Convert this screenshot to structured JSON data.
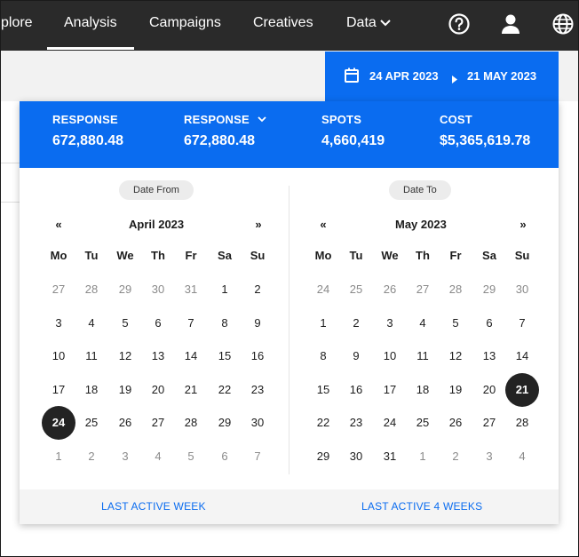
{
  "nav": {
    "items": [
      {
        "label": "plore",
        "active": false
      },
      {
        "label": "Analysis",
        "active": true
      },
      {
        "label": "Campaigns",
        "active": false
      },
      {
        "label": "Creatives",
        "active": false
      },
      {
        "label": "Data",
        "active": false
      }
    ],
    "icons": [
      "help-icon",
      "user-icon",
      "globe-icon"
    ]
  },
  "date_range": {
    "from": "24 APR 2023",
    "to": "21 MAY 2023"
  },
  "stats": [
    {
      "label": "RESPONSE",
      "value": "672,880.48",
      "has_dropdown": false
    },
    {
      "label": "RESPONSE",
      "value": "672,880.48",
      "has_dropdown": true
    },
    {
      "label": "SPOTS",
      "value": "4,660,419",
      "has_dropdown": false
    },
    {
      "label": "COST",
      "value": "$5,365,619.78",
      "has_dropdown": false
    }
  ],
  "weekday_labels": [
    "Mo",
    "Tu",
    "We",
    "Th",
    "Fr",
    "Sa",
    "Su"
  ],
  "calendars": [
    {
      "pill": "Date From",
      "month": "April 2023",
      "prev": "«",
      "next": "»",
      "days": [
        [
          "27",
          "28",
          "29",
          "30",
          "31",
          "1",
          "2"
        ],
        [
          "3",
          "4",
          "5",
          "6",
          "7",
          "8",
          "9"
        ],
        [
          "10",
          "11",
          "12",
          "13",
          "14",
          "15",
          "16"
        ],
        [
          "17",
          "18",
          "19",
          "20",
          "21",
          "22",
          "23"
        ],
        [
          "24",
          "25",
          "26",
          "27",
          "28",
          "29",
          "30"
        ],
        [
          "1",
          "2",
          "3",
          "4",
          "5",
          "6",
          "7"
        ]
      ],
      "muted": [
        [
          0,
          0
        ],
        [
          0,
          1
        ],
        [
          0,
          2
        ],
        [
          0,
          3
        ],
        [
          0,
          4
        ],
        [
          5,
          0
        ],
        [
          5,
          1
        ],
        [
          5,
          2
        ],
        [
          5,
          3
        ],
        [
          5,
          4
        ],
        [
          5,
          5
        ],
        [
          5,
          6
        ]
      ],
      "selected": [
        4,
        0
      ]
    },
    {
      "pill": "Date To",
      "month": "May 2023",
      "prev": "«",
      "next": "»",
      "days": [
        [
          "24",
          "25",
          "26",
          "27",
          "28",
          "29",
          "30"
        ],
        [
          "1",
          "2",
          "3",
          "4",
          "5",
          "6",
          "7"
        ],
        [
          "8",
          "9",
          "10",
          "11",
          "12",
          "13",
          "14"
        ],
        [
          "15",
          "16",
          "17",
          "18",
          "19",
          "20",
          "21"
        ],
        [
          "22",
          "23",
          "24",
          "25",
          "26",
          "27",
          "28"
        ],
        [
          "29",
          "30",
          "31",
          "1",
          "2",
          "3",
          "4"
        ]
      ],
      "muted": [
        [
          0,
          0
        ],
        [
          0,
          1
        ],
        [
          0,
          2
        ],
        [
          0,
          3
        ],
        [
          0,
          4
        ],
        [
          0,
          5
        ],
        [
          0,
          6
        ],
        [
          5,
          3
        ],
        [
          5,
          4
        ],
        [
          5,
          5
        ],
        [
          5,
          6
        ]
      ],
      "selected": [
        3,
        6
      ]
    }
  ],
  "footer": {
    "left": "LAST ACTIVE WEEK",
    "right": "LAST ACTIVE 4 WEEKS"
  },
  "colors": {
    "accent": "#0a6cf0",
    "nav_bg": "#2a2a2a",
    "selected_day": "#232323"
  }
}
